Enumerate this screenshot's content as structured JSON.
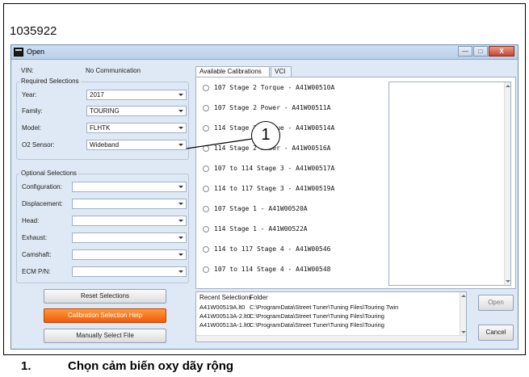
{
  "figure_id": "1035922",
  "window": {
    "title": "Open",
    "controls": [
      "—",
      "□",
      "X"
    ]
  },
  "left": {
    "vin_label": "VIN:",
    "vin_value": "No Communication",
    "required": {
      "title": "Required Selections",
      "fields": [
        {
          "label": "Year:",
          "value": "2017"
        },
        {
          "label": "Family:",
          "value": "TOURING"
        },
        {
          "label": "Model:",
          "value": "FLHTK"
        },
        {
          "label": "O2 Sensor:",
          "value": "Wideband"
        }
      ]
    },
    "optional": {
      "title": "Optional Selections",
      "fields": [
        {
          "label": "Configuration:",
          "value": ""
        },
        {
          "label": "Displacement:",
          "value": ""
        },
        {
          "label": "Head:",
          "value": ""
        },
        {
          "label": "Exhaust:",
          "value": ""
        },
        {
          "label": "Camshaft:",
          "value": ""
        },
        {
          "label": "ECM P/N:",
          "value": ""
        }
      ]
    },
    "buttons": {
      "reset": "Reset Selections",
      "help": "Calibration Selection Help",
      "manual": "Manually Select File"
    }
  },
  "tabs": [
    {
      "label": "Available Calibrations",
      "active": true
    },
    {
      "label": "VCI",
      "active": false
    }
  ],
  "calibrations": [
    "107 Stage 2 Torque - A41W00510A",
    "107 Stage 2 Power - A41W00511A",
    "114 Stage 2 Torque - A41W00514A",
    "114 Stage 2 Power - A41W00516A",
    "107 to 114 Stage 3 - A41W00517A",
    "114 to 117 Stage 3 - A41W00519A",
    "107 Stage 1 - A41W00520A",
    "114 Stage 1 - A41W00522A",
    "114 to 117 Stage 4 - A41W00546",
    "107 to 114 Stage 4 - A41W00548"
  ],
  "recent": {
    "col_file": "Recent Selections",
    "col_folder": "Folder",
    "rows": [
      {
        "file": "A41W00519A.lt0",
        "folder": "C:\\ProgramData\\Street Tuner\\Tuning Files\\Touring Twin"
      },
      {
        "file": "A41W00513A-2.lt0",
        "folder": "C:\\ProgramData\\Street Tuner\\Tuning Files\\Touring"
      },
      {
        "file": "A41W00513A-1.lt0",
        "folder": "C:\\ProgramData\\Street Tuner\\Tuning Files\\Touring"
      }
    ]
  },
  "actions": {
    "open": "Open",
    "cancel": "Cancel"
  },
  "callout": {
    "number": "1"
  },
  "caption": {
    "number": "1.",
    "text": "Chọn cảm biến oxy dãy rộng"
  },
  "colors": {
    "accent_orange": "#f25a0c",
    "window_bg": "#dfe9f5"
  }
}
